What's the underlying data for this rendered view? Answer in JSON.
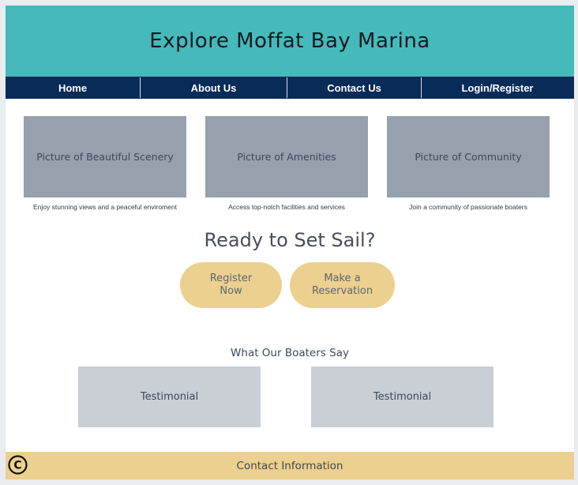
{
  "header": {
    "title": "Explore Moffat Bay Marina"
  },
  "nav": {
    "items": [
      {
        "label": "Home"
      },
      {
        "label": "About Us"
      },
      {
        "label": "Contact Us"
      },
      {
        "label": "Login/Register"
      }
    ]
  },
  "features": [
    {
      "image_label": "Picture of Beautiful Scenery",
      "caption": "Enjoy stunning views and a peaceful enviroment"
    },
    {
      "image_label": "Picture of Amenities",
      "caption": "Access top-notch facilities and services"
    },
    {
      "image_label": "Picture of Community",
      "caption": "Join a community of passionate boaters"
    }
  ],
  "cta": {
    "heading": "Ready to Set Sail?",
    "register_line1": "Register",
    "register_line2": "Now",
    "reserve_line1": "Make a",
    "reserve_line2": "Reservation"
  },
  "testimonials": {
    "heading": "What Our Boaters Say",
    "items": [
      {
        "label": "Testimonial"
      },
      {
        "label": "Testimonial"
      }
    ]
  },
  "footer": {
    "label": "Contact Information",
    "copyright_icon": "copyright-icon"
  },
  "colors": {
    "header_bg": "#46b9ba",
    "nav_bg": "#082b57",
    "placeholder_bg": "#97a0ad",
    "accent": "#ecd08f",
    "testimonial_bg": "#c9cfd5"
  }
}
